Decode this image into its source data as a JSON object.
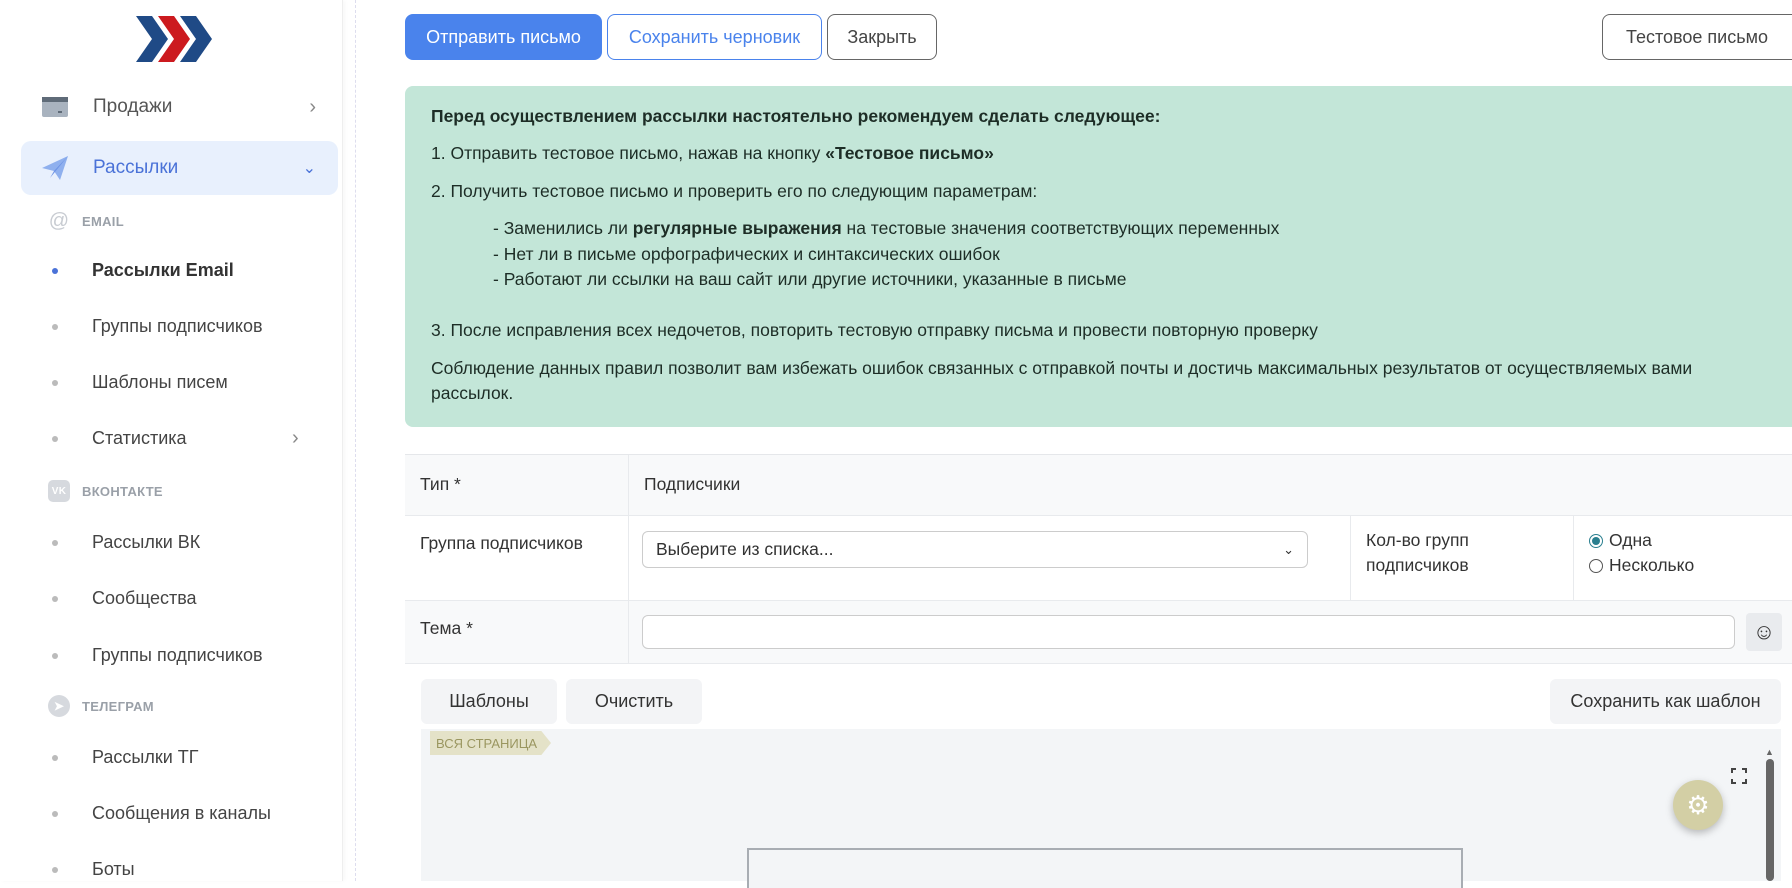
{
  "sidebar": {
    "items": [
      {
        "label": "Продажи",
        "icon": "card-icon"
      },
      {
        "label": "Рассылки",
        "icon": "paper-plane-icon"
      }
    ],
    "sections": [
      {
        "title": "EMAIL",
        "icon": "at-icon",
        "items": [
          "Рассылки Email",
          "Группы подписчиков",
          "Шаблоны писем",
          "Статистика"
        ]
      },
      {
        "title": "ВКОНТАКТЕ",
        "icon": "vk-icon",
        "items": [
          "Рассылки ВК",
          "Сообщества",
          "Группы подписчиков"
        ]
      },
      {
        "title": "ТЕЛЕГРАМ",
        "icon": "telegram-icon",
        "items": [
          "Рассылки ТГ",
          "Сообщения в каналы",
          "Боты"
        ]
      }
    ]
  },
  "toolbar": {
    "send": "Отправить письмо",
    "save_draft": "Сохранить черновик",
    "close": "Закрыть",
    "test": "Тестовое письмо"
  },
  "notice": {
    "heading": "Перед осуществлением рассылки настоятельно рекомендуем сделать следующее:",
    "step1_prefix": "1. Отправить тестовое письмо, нажав на кнопку ",
    "step1_bold": "«Тестовое письмо»",
    "step2": "2. Получить тестовое письмо и проверить его по следующим параметрам:",
    "check1_prefix": "- Заменились ли ",
    "check1_bold": "регулярные выражения",
    "check1_suffix": " на тестовые значения соответствующих переменных",
    "check2": "- Нет ли в письме орфографических и синтаксических ошибок",
    "check3": "- Работают ли ссылки на ваш сайт или другие источники, указанные в письме",
    "step3": "3. После исправления всех недочетов, повторить тестовую отправку письма и провести повторную проверку",
    "footer": "Соблюдение данных правил позволит вам избежать ошибок связанных с отправкой почты и достичь максимальных результатов от осуществляемых вами рассылок."
  },
  "form": {
    "type_label": "Тип *",
    "type_value": "Подписчики",
    "group_label": "Группа подписчиков",
    "group_placeholder": "Выберите из списка...",
    "count_label": "Кол-во групп подписчиков",
    "count_options": [
      "Одна",
      "Несколько"
    ],
    "count_selected": "Одна",
    "subject_label": "Тема *",
    "subject_value": ""
  },
  "editor": {
    "templates": "Шаблоны",
    "clear": "Очистить",
    "save_template": "Сохранить как шаблон",
    "tag": "ВСЯ СТРАНИЦА"
  },
  "colors": {
    "primary": "#4a83ec",
    "notice": "#c3e6d8",
    "gear": "#d3cfa5"
  }
}
